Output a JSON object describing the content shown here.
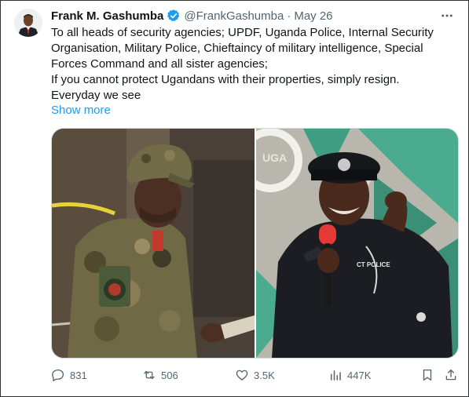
{
  "tweet": {
    "author_name": "Frank M. Gashumba",
    "handle": "@FrankGashumba",
    "separator": "·",
    "date": "May 26",
    "lines": [
      "To all heads of security agencies; UPDF, Uganda Police, Internal Security",
      "Organisation, Military Police, Chieftaincy of military intelligence, Special",
      "Forces Command and all sister agencies;",
      "If you cannot protect Ugandans with their properties, simply resign.",
      "Everyday we see"
    ],
    "show_more": "Show more",
    "photo_text": {
      "badge": "CT POLICE",
      "banner": "UGA"
    }
  },
  "actions": {
    "replies": "831",
    "reposts": "506",
    "likes": "3.5K",
    "views": "447K"
  },
  "icons": {
    "verified": "verified-badge-icon",
    "more": "more-icon",
    "reply": "reply-icon",
    "repost": "repost-icon",
    "like": "like-icon",
    "views": "views-icon",
    "bookmark": "bookmark-icon",
    "share": "share-icon"
  },
  "colors": {
    "accent": "#1d9bf0",
    "text": "#0f1419",
    "secondary": "#536471",
    "border": "#cfd9de"
  }
}
